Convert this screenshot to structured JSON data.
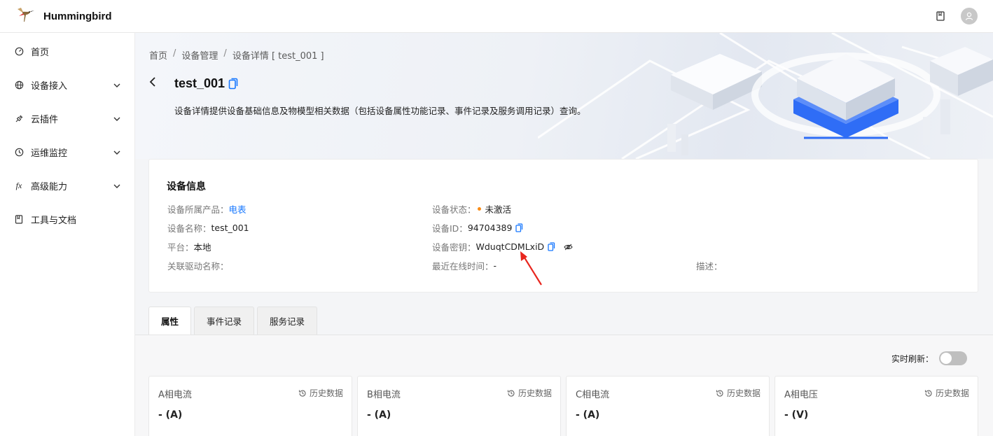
{
  "app": {
    "name": "Hummingbird"
  },
  "sidebar": {
    "items": [
      {
        "label": "首页",
        "icon": "dashboard-icon",
        "expandable": false
      },
      {
        "label": "设备接入",
        "icon": "globe-icon",
        "expandable": true
      },
      {
        "label": "云插件",
        "icon": "plugin-icon",
        "expandable": true
      },
      {
        "label": "运维监控",
        "icon": "clock-icon",
        "expandable": true
      },
      {
        "label": "高级能力",
        "icon": "function-icon",
        "expandable": true
      },
      {
        "label": "工具与文档",
        "icon": "book-icon",
        "expandable": false
      }
    ]
  },
  "breadcrumb": {
    "home": "首页",
    "device_mgmt": "设备管理",
    "current": "设备详情 [ test_001 ]"
  },
  "page": {
    "title": "test_001",
    "subtitle": "设备详情提供设备基础信息及物模型相关数据（包括设备属性功能记录、事件记录及服务调用记录）查询。"
  },
  "device_info": {
    "title": "设备信息",
    "product_label": "设备所属产品：",
    "product_value": "电表",
    "name_label": "设备名称：",
    "name_value": "test_001",
    "platform_label": "平台：",
    "platform_value": "本地",
    "driver_label": "关联驱动名称：",
    "driver_value": "",
    "status_label": "设备状态：",
    "status_value": "未激活",
    "status_color": "#fa8c16",
    "id_label": "设备ID：",
    "id_value": "94704389",
    "secret_label": "设备密钥：",
    "secret_value": "WduqtCDMLxiD",
    "last_online_label": "最近在线时间：",
    "last_online_value": "-",
    "desc_label": "描述：",
    "desc_value": ""
  },
  "tabs": [
    {
      "label": "属性",
      "active": true
    },
    {
      "label": "事件记录",
      "active": false
    },
    {
      "label": "服务记录",
      "active": false
    }
  ],
  "realtime": {
    "label": "实时刷新：",
    "enabled": false
  },
  "properties": [
    {
      "name": "A相电流",
      "value": "- (A)",
      "history_label": "历史数据"
    },
    {
      "name": "B相电流",
      "value": "- (A)",
      "history_label": "历史数据"
    },
    {
      "name": "C相电流",
      "value": "- (A)",
      "history_label": "历史数据"
    },
    {
      "name": "A相电压",
      "value": "- (V)",
      "history_label": "历史数据"
    }
  ],
  "colors": {
    "accent": "#1677ff",
    "annotation": "#e8261e"
  }
}
